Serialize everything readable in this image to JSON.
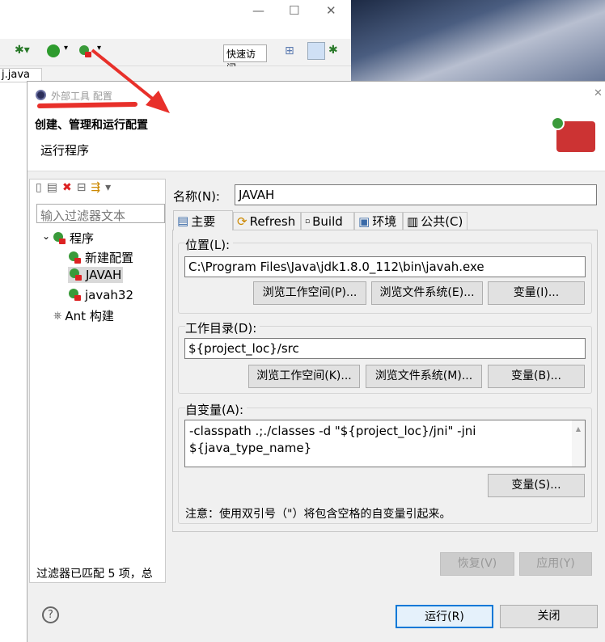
{
  "ide": {
    "quick_access": "快速访问",
    "editor_tab": "j.java"
  },
  "dialog": {
    "title": "外部工具 配置",
    "heading": "创建、管理和运行配置",
    "subheading": "运行程序",
    "filter_placeholder": "输入过滤器文本",
    "tree": [
      {
        "label": "程序",
        "level": 0,
        "expanded": true
      },
      {
        "label": "新建配置",
        "level": 1
      },
      {
        "label": "JAVAH",
        "level": 1,
        "selected": true
      },
      {
        "label": "javah32",
        "level": 1
      },
      {
        "label": "Ant 构建",
        "level": 0
      }
    ],
    "filter_status": "过滤器已匹配 5 项，总",
    "name_label": "名称(N):",
    "name_value": "JAVAH",
    "tabs": [
      {
        "label": "主要",
        "active": true
      },
      {
        "label": "Refresh"
      },
      {
        "label": "Build"
      },
      {
        "label": "环境"
      },
      {
        "label": "公共(C)"
      }
    ],
    "location": {
      "label": "位置(L):",
      "value": "C:\\Program Files\\Java\\jdk1.8.0_112\\bin\\javah.exe",
      "browse_workspace": "浏览工作空间(P)...",
      "browse_fs": "浏览文件系统(E)...",
      "variables": "变量(I)..."
    },
    "workdir": {
      "label": "工作目录(D):",
      "value": "${project_loc}/src",
      "browse_workspace": "浏览工作空间(K)...",
      "browse_fs": "浏览文件系统(M)...",
      "variables": "变量(B)..."
    },
    "args": {
      "label": "自变量(A):",
      "line1": "-classpath .;./classes -d  \"${project_loc}/jni\" -jni",
      "line2": "${java_type_name}",
      "variables": "变量(S)...",
      "note": "注意：使用双引号（\"）将包含空格的自变量引起来。"
    },
    "revert": "恢复(V)",
    "apply": "应用(Y)",
    "run": "运行(R)",
    "close": "关闭",
    "help": "?"
  },
  "colors": {
    "annotation": "#e8302a",
    "selected": "#d9d9d9",
    "focus_border": "#0078d7"
  }
}
